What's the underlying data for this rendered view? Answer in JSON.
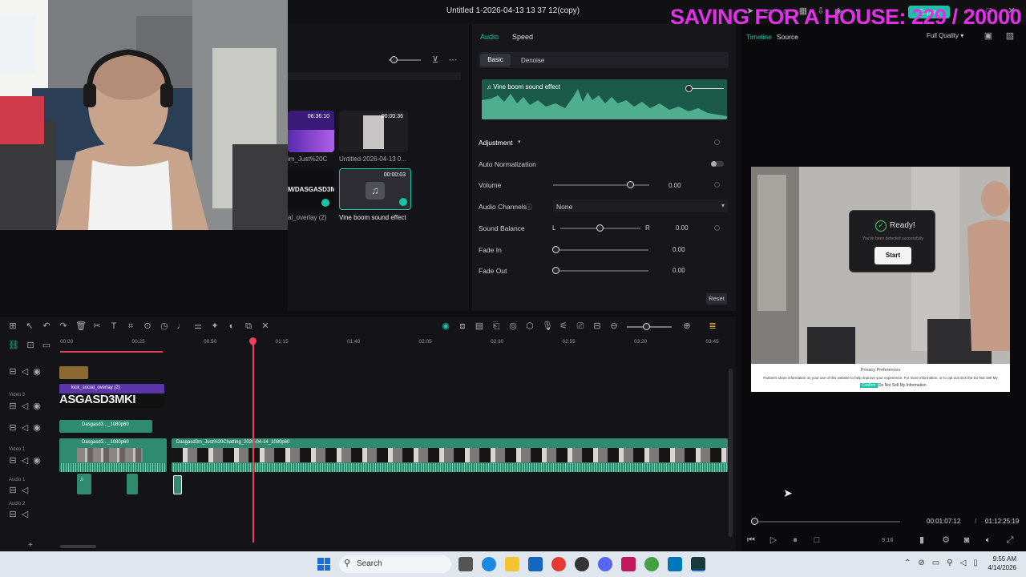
{
  "window": {
    "title": "Untitled 1-2026-04-13 13 37 12(copy)",
    "export_label": "Export"
  },
  "overlay": {
    "saving_text": "SAVING FOR A HOUSE: 229 / 20000"
  },
  "media": {
    "items": [
      {
        "duration": "06:36:10",
        "label": "im_Just%20C"
      },
      {
        "duration": "00:00:36",
        "label": "Untitled-2026-04-13 0..."
      },
      {
        "duration": "",
        "label": "M/DASGASD3M",
        "sub": "al_overlay (2)"
      },
      {
        "duration": "00:00:03",
        "label": "Vine boom sound effect"
      }
    ]
  },
  "properties": {
    "tabs": [
      "Audio",
      "Speed"
    ],
    "subtabs": [
      "Basic",
      "Denoise"
    ],
    "clip_name": "Vine boom sound effect",
    "section": "Adjustment",
    "auto_normalization": "Auto Normalization",
    "volume": {
      "label": "Volume",
      "value": "0.00"
    },
    "channels": {
      "label": "Audio Channels",
      "value": "None"
    },
    "balance": {
      "label": "Sound Balance",
      "left": "L",
      "right": "R",
      "value": "0.00"
    },
    "fade_in": {
      "label": "Fade In",
      "value": "0.00"
    },
    "fade_out": {
      "label": "Fade Out",
      "value": "0.00"
    },
    "reset": "Reset"
  },
  "preview": {
    "tabs": [
      "Timeline",
      "Source"
    ],
    "quality": "Full Quality",
    "ready_text": "Ready!",
    "ready_sub": "You've been detected successfully",
    "start": "Start",
    "privacy_title": "Privacy Preferences",
    "privacy_text": "Partners share information on your use of this website to help improve your experience. For more information, or to opt out click the Do Not Sell My",
    "privacy_confirm": "Confirm",
    "privacy_dns": "Do Not Sell My Information",
    "current_time": "00:01:07:12",
    "total_time": "01:12:25:19",
    "ratio": "9:16",
    "progress": 0.02
  },
  "timeline": {
    "ruler": [
      "00:00",
      "00:25",
      "00:50",
      "01:15",
      "01:40",
      "02:05",
      "02:30",
      "02:55",
      "03:20",
      "03:45"
    ],
    "tracks": [
      {
        "name": ""
      },
      {
        "name": "Video 3"
      },
      {
        "name": ""
      },
      {
        "name": "Video 1"
      },
      {
        "name": "Audio 1"
      },
      {
        "name": "Audio 2"
      }
    ],
    "clips": {
      "overlay_label": "kick_social_overlay (2)",
      "overlay_text": "ASGASD3MKI",
      "v2_label": "Dasgasd3..._1080p60",
      "v1a_label": "Dasgasd3..._1080p60",
      "v1b_label": "Dasgasd3m_Just%20Chatting_2026-04-14_1080p60"
    }
  },
  "taskbar": {
    "search": "Search",
    "time": "9:55 AM",
    "date": "4/14/2026"
  },
  "colors": {
    "accent": "#19c3a6",
    "overlay": "#e030e8",
    "playhead": "#f0405a",
    "audio_clip": "#2e8b6e"
  }
}
